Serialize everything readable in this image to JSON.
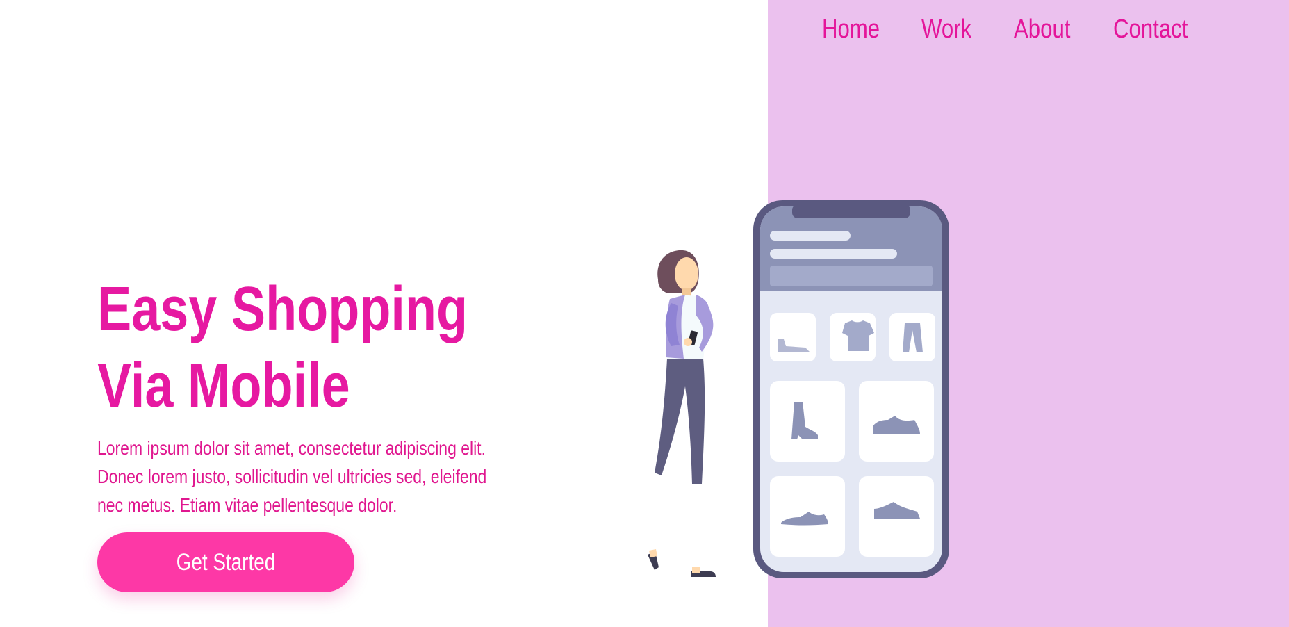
{
  "nav": {
    "items": [
      {
        "label": "Home"
      },
      {
        "label": "Work"
      },
      {
        "label": "About"
      },
      {
        "label": "Contact"
      }
    ]
  },
  "hero": {
    "title_line1": "Easy Shopping",
    "title_line2": "Via Mobile",
    "body": "Lorem ipsum dolor sit amet, consectetur adipiscing elit. Donec lorem justo, sollicitudin vel ultricies sed, eleifend nec metus. Etiam vitae pellentesque dolor.",
    "cta_label": "Get Started"
  },
  "colors": {
    "accent": "#e619a1",
    "button": "#fd38a6",
    "panel": "#ebc1ee",
    "phone_frame": "#5a5980",
    "phone_header": "#8c93b6",
    "phone_screen": "#e4e8f4"
  },
  "illustration": {
    "phone_categories": [
      "flat-shoe-icon",
      "tshirt-icon",
      "pants-icon"
    ],
    "phone_products": [
      "boot-icon",
      "sneaker-icon",
      "sneaker-icon",
      "sneaker-icon"
    ]
  }
}
